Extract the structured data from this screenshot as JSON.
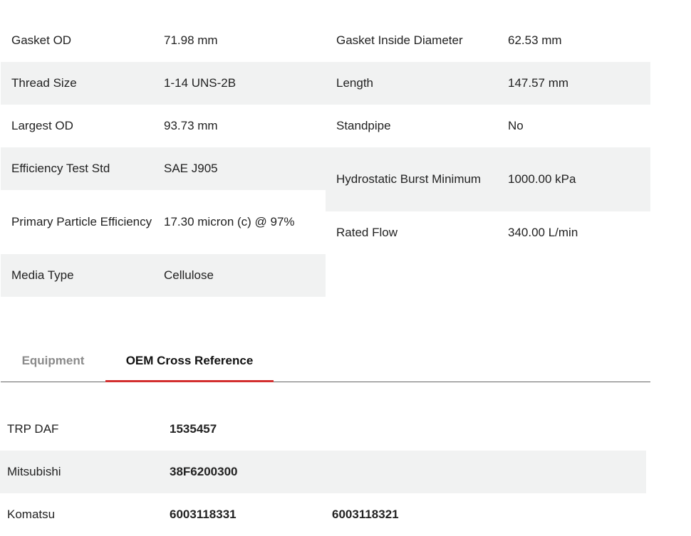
{
  "specs_left": [
    {
      "label": "Gasket OD",
      "value": "71.98 mm"
    },
    {
      "label": "Thread Size",
      "value": "1-14 UNS-2B"
    },
    {
      "label": "Largest OD",
      "value": "93.73 mm"
    },
    {
      "label": "Efficiency Test Std",
      "value": "SAE J905"
    },
    {
      "label": "Primary Particle Efficiency",
      "value": "17.30 micron (c) @ 97%"
    },
    {
      "label": "Media Type",
      "value": "Cellulose"
    }
  ],
  "specs_right": [
    {
      "label": "Gasket Inside Diameter",
      "value": "62.53 mm"
    },
    {
      "label": "Length",
      "value": "147.57 mm"
    },
    {
      "label": "Standpipe",
      "value": "No"
    },
    {
      "label": "Hydrostatic Burst Minimum",
      "value": "1000.00 kPa"
    },
    {
      "label": "Rated Flow",
      "value": "340.00 L/min"
    }
  ],
  "tabs": [
    {
      "label": "Equipment",
      "active": false
    },
    {
      "label": "OEM Cross Reference",
      "active": true
    }
  ],
  "cross_reference": [
    {
      "brand": "TRP DAF",
      "parts": [
        "1535457"
      ]
    },
    {
      "brand": "Mitsubishi",
      "parts": [
        "38F6200300"
      ]
    },
    {
      "brand": "Komatsu",
      "parts": [
        "6003118331",
        "6003118321"
      ]
    }
  ],
  "colors": {
    "accent": "#d32f2f",
    "row_shade": "#f1f2f2",
    "inactive_tab": "#8a8a8a"
  }
}
